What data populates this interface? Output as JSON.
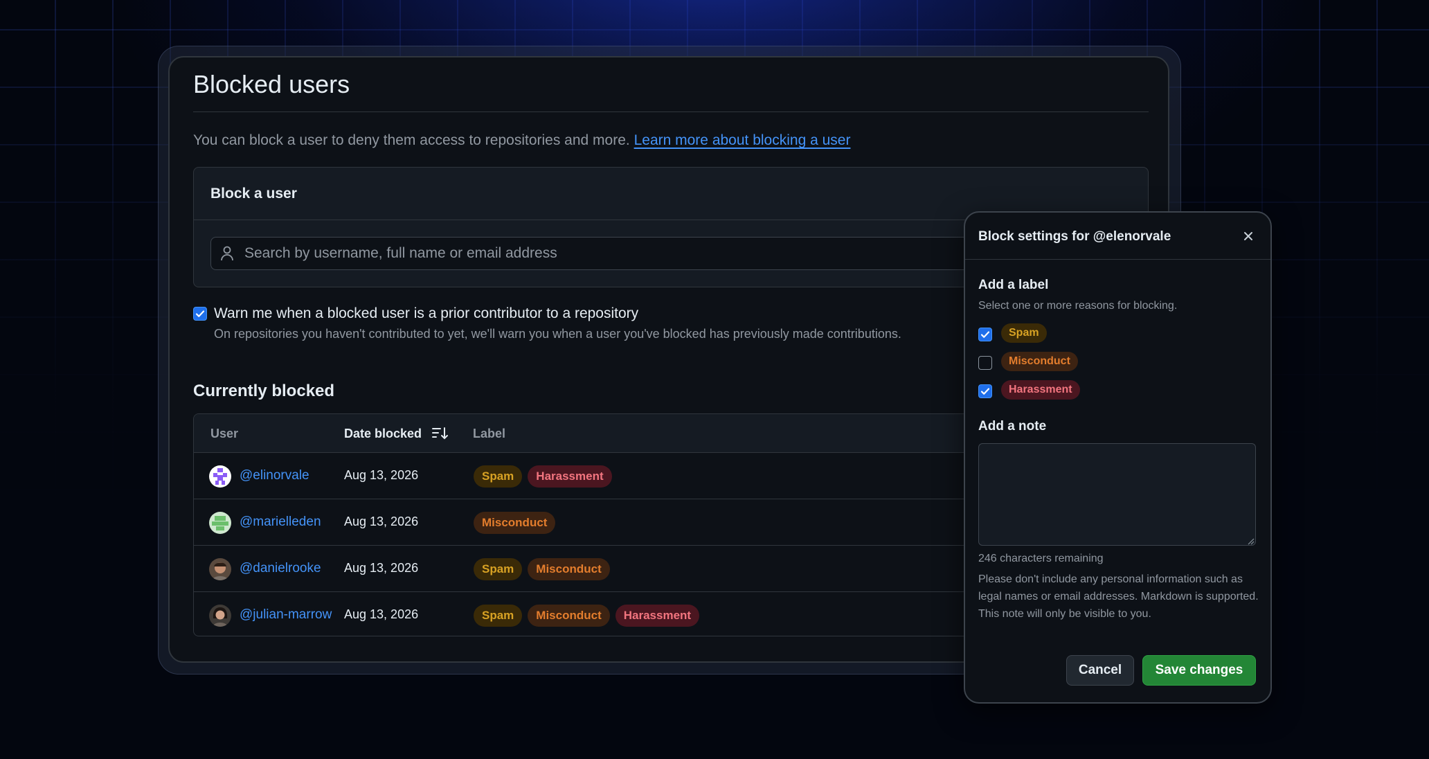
{
  "page": {
    "title": "Blocked users",
    "intro_text": "You can block a user to deny them access to repositories and more.",
    "intro_link": "Learn more about blocking a user"
  },
  "block_user": {
    "heading": "Block a user",
    "search_placeholder": "Search by username, full name or email address",
    "search_icon": "person-icon"
  },
  "warn_option": {
    "checked": true,
    "label": "Warn me when a blocked user is a prior contributor to a repository",
    "description": "On repositories you haven't contributed to yet, we'll warn you when a user you've blocked has previously made contributions."
  },
  "currently_blocked": {
    "heading": "Currently blocked",
    "columns": {
      "user": "User",
      "date": "Date blocked",
      "label": "Label"
    },
    "sort_icon": "sort-desc-icon",
    "rows": [
      {
        "username": "@elinorvale",
        "date": "Aug 13, 2026",
        "labels": [
          "Spam",
          "Harassment"
        ]
      },
      {
        "username": "@marielleden",
        "date": "Aug 13, 2026",
        "labels": [
          "Misconduct"
        ]
      },
      {
        "username": "@danielrooke",
        "date": "Aug 13, 2026",
        "labels": [
          "Spam",
          "Misconduct"
        ]
      },
      {
        "username": "@julian-marrow",
        "date": "Aug 13, 2026",
        "labels": [
          "Spam",
          "Misconduct",
          "Harassment"
        ]
      }
    ]
  },
  "colors": {
    "accent": "#4493f8",
    "spam": "#d8a224",
    "misconduct": "#e37d2d",
    "harassment": "#f2757f",
    "save": "#238636"
  },
  "dialog": {
    "title": "Block settings for @elenorvale",
    "close_icon": "close-icon",
    "label_heading": "Add a label",
    "label_sub": "Select one or more reasons for blocking.",
    "options": [
      {
        "label": "Spam",
        "checked": true
      },
      {
        "label": "Misconduct",
        "checked": false
      },
      {
        "label": "Harassment",
        "checked": true
      }
    ],
    "note_heading": "Add a note",
    "note_value": "",
    "remaining": "246 characters remaining",
    "help": "Please don't include any personal information such as legal names or email addresses. Markdown is supported. This note will only be visible to you.",
    "cancel": "Cancel",
    "save": "Save changes"
  }
}
